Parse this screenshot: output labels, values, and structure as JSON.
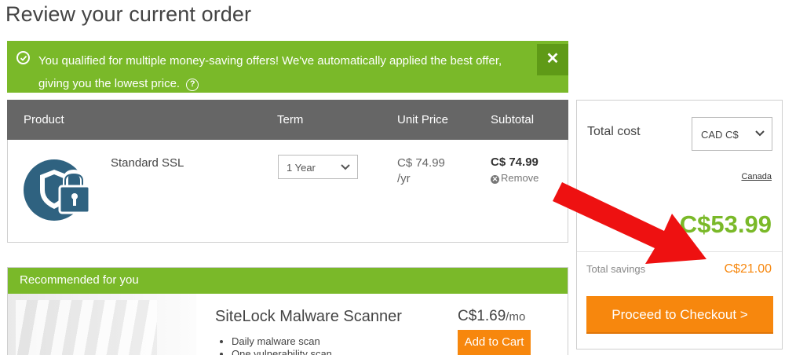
{
  "page": {
    "title": "Review your current order"
  },
  "banner": {
    "message": "You qualified for multiple money-saving offers! We've automatically applied the best offer, giving you the lowest price.",
    "help_symbol": "?",
    "close_symbol": "✕",
    "color": "#7ab929"
  },
  "order": {
    "columns": {
      "product": "Product",
      "term": "Term",
      "unit_price": "Unit Price",
      "subtotal": "Subtotal"
    },
    "items": [
      {
        "icon": "ssl-shield-lock-icon",
        "name": "Standard SSL",
        "term": "1 Year",
        "unit_price": "C$ 74.99\n/yr",
        "subtotal": "C$ 74.99",
        "remove_label": "Remove",
        "remove_symbol": "✕"
      }
    ]
  },
  "recommended": {
    "header": "Recommended for you",
    "product": {
      "name": "SiteLock Malware Scanner",
      "price": "C$1.69",
      "price_unit": "/mo",
      "features": [
        "Daily malware scan",
        "One vulnerability scan"
      ],
      "add_label": "Add to Cart"
    }
  },
  "summary": {
    "total_label": "Total cost",
    "currency": "CAD C$",
    "country": "Canada",
    "total": "C$53.99",
    "savings_label": "Total savings",
    "savings": "C$21.00",
    "checkout_label": "Proceed to Checkout >",
    "colors": {
      "accent_green": "#7ab929",
      "accent_orange": "#f7870d"
    }
  },
  "annotation": {
    "arrow_color": "#ee1111",
    "arrow_icon": "red-arrow-icon"
  }
}
